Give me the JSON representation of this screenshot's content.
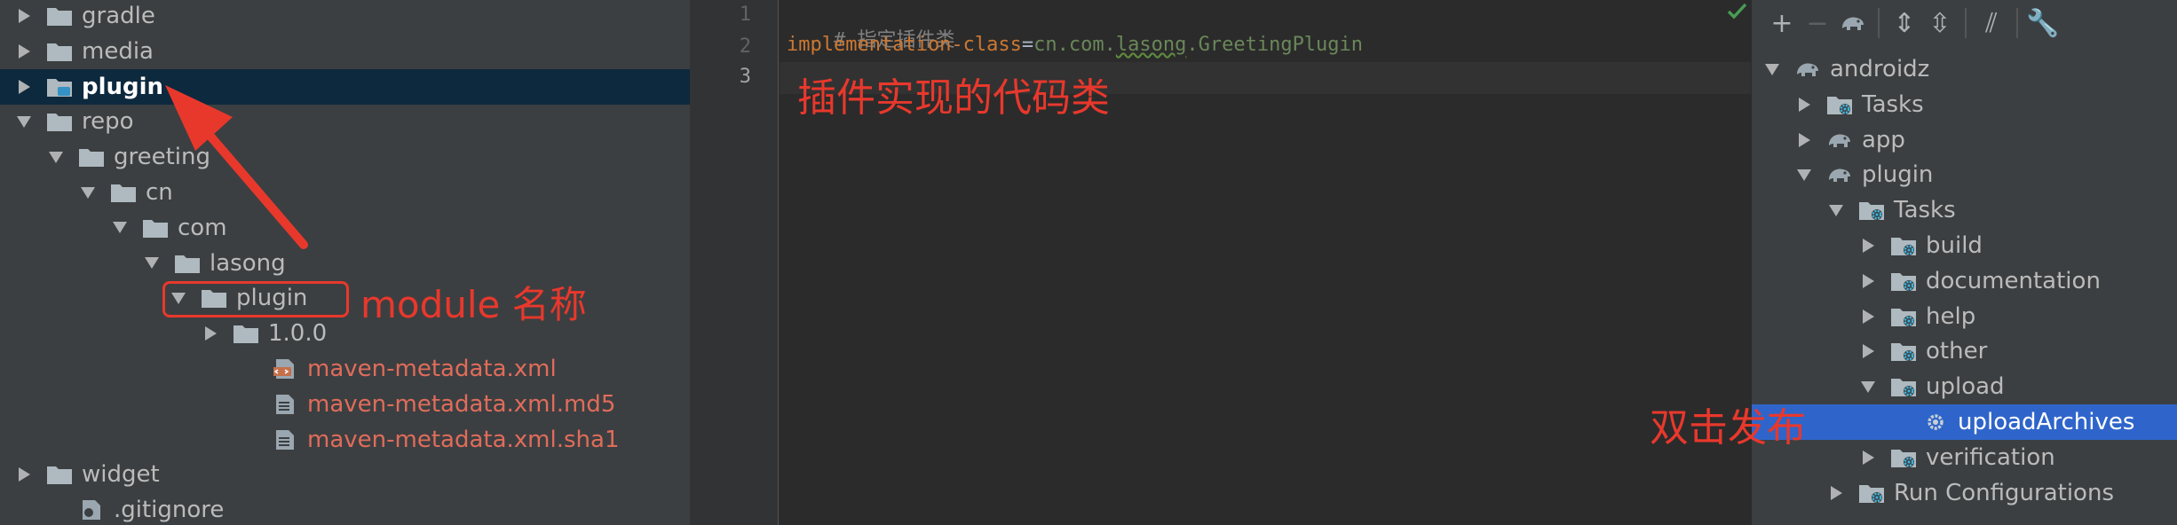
{
  "project_tree": {
    "rows": [
      {
        "label": "gradle",
        "icon": "folder-icon",
        "state": "collapsed"
      },
      {
        "label": "media",
        "icon": "folder-icon",
        "state": "collapsed"
      },
      {
        "label": "plugin",
        "icon": "module-folder-icon",
        "state": "collapsed",
        "selected": true
      },
      {
        "label": "repo",
        "icon": "folder-icon",
        "state": "expanded"
      },
      {
        "label": "greeting",
        "icon": "folder-icon",
        "state": "expanded"
      },
      {
        "label": "cn",
        "icon": "folder-icon",
        "state": "expanded"
      },
      {
        "label": "com",
        "icon": "folder-icon",
        "state": "expanded"
      },
      {
        "label": "lasong",
        "icon": "folder-icon",
        "state": "expanded"
      },
      {
        "label": "plugin",
        "icon": "folder-icon",
        "state": "expanded"
      },
      {
        "label": "1.0.0",
        "icon": "folder-icon",
        "state": "collapsed"
      },
      {
        "label": "maven-metadata.xml",
        "icon": "xml-file-icon",
        "state": "none",
        "red": true
      },
      {
        "label": "maven-metadata.xml.md5",
        "icon": "text-file-icon",
        "state": "none",
        "red": true
      },
      {
        "label": "maven-metadata.xml.sha1",
        "icon": "text-file-icon",
        "state": "none",
        "red": true
      },
      {
        "label": "widget",
        "icon": "folder-icon",
        "state": "collapsed"
      },
      {
        "label": ".gitignore",
        "icon": "gitignore-file-icon",
        "state": "none"
      }
    ]
  },
  "editor": {
    "line_numbers": [
      "1",
      "2",
      "3"
    ],
    "line1": {
      "comment": "# 指定插件类"
    },
    "line2": {
      "key": "implementation-class",
      "eq": "=",
      "val_a": "cn.com.",
      "val_typo": "lasong",
      "val_b": ".GreetingPlugin"
    }
  },
  "gradle": {
    "toolbar": [
      "add-icon",
      "remove-icon",
      "elephant-icon",
      "expand-all-icon",
      "collapse-all-icon",
      "toggle-offline-icon",
      "wrench-icon"
    ],
    "rows": [
      {
        "label": "androidz",
        "icon": "elephant-icon",
        "state": "expanded"
      },
      {
        "label": "Tasks",
        "icon": "tasks-folder-icon",
        "state": "collapsed"
      },
      {
        "label": "app",
        "icon": "elephant-icon",
        "state": "collapsed"
      },
      {
        "label": "plugin",
        "icon": "elephant-icon",
        "state": "expanded"
      },
      {
        "label": "Tasks",
        "icon": "tasks-folder-icon",
        "state": "expanded"
      },
      {
        "label": "build",
        "icon": "tasks-folder-icon",
        "state": "collapsed"
      },
      {
        "label": "documentation",
        "icon": "tasks-folder-icon",
        "state": "collapsed"
      },
      {
        "label": "help",
        "icon": "tasks-folder-icon",
        "state": "collapsed"
      },
      {
        "label": "other",
        "icon": "tasks-folder-icon",
        "state": "collapsed"
      },
      {
        "label": "upload",
        "icon": "tasks-folder-icon",
        "state": "expanded"
      },
      {
        "label": "uploadArchives",
        "icon": "gear-icon",
        "state": "none",
        "selected": true
      },
      {
        "label": "verification",
        "icon": "tasks-folder-icon",
        "state": "collapsed"
      },
      {
        "label": "Run Configurations",
        "icon": "tasks-folder-icon",
        "state": "collapsed"
      }
    ]
  },
  "annotations": {
    "module_name": "module 名称",
    "code_class": "插件实现的代码类",
    "double_click": "双击发布"
  },
  "colors": {
    "annotation_red": "#e8382c",
    "selection_blue": "#2f65ca",
    "tree_selection": "#0d293e"
  }
}
